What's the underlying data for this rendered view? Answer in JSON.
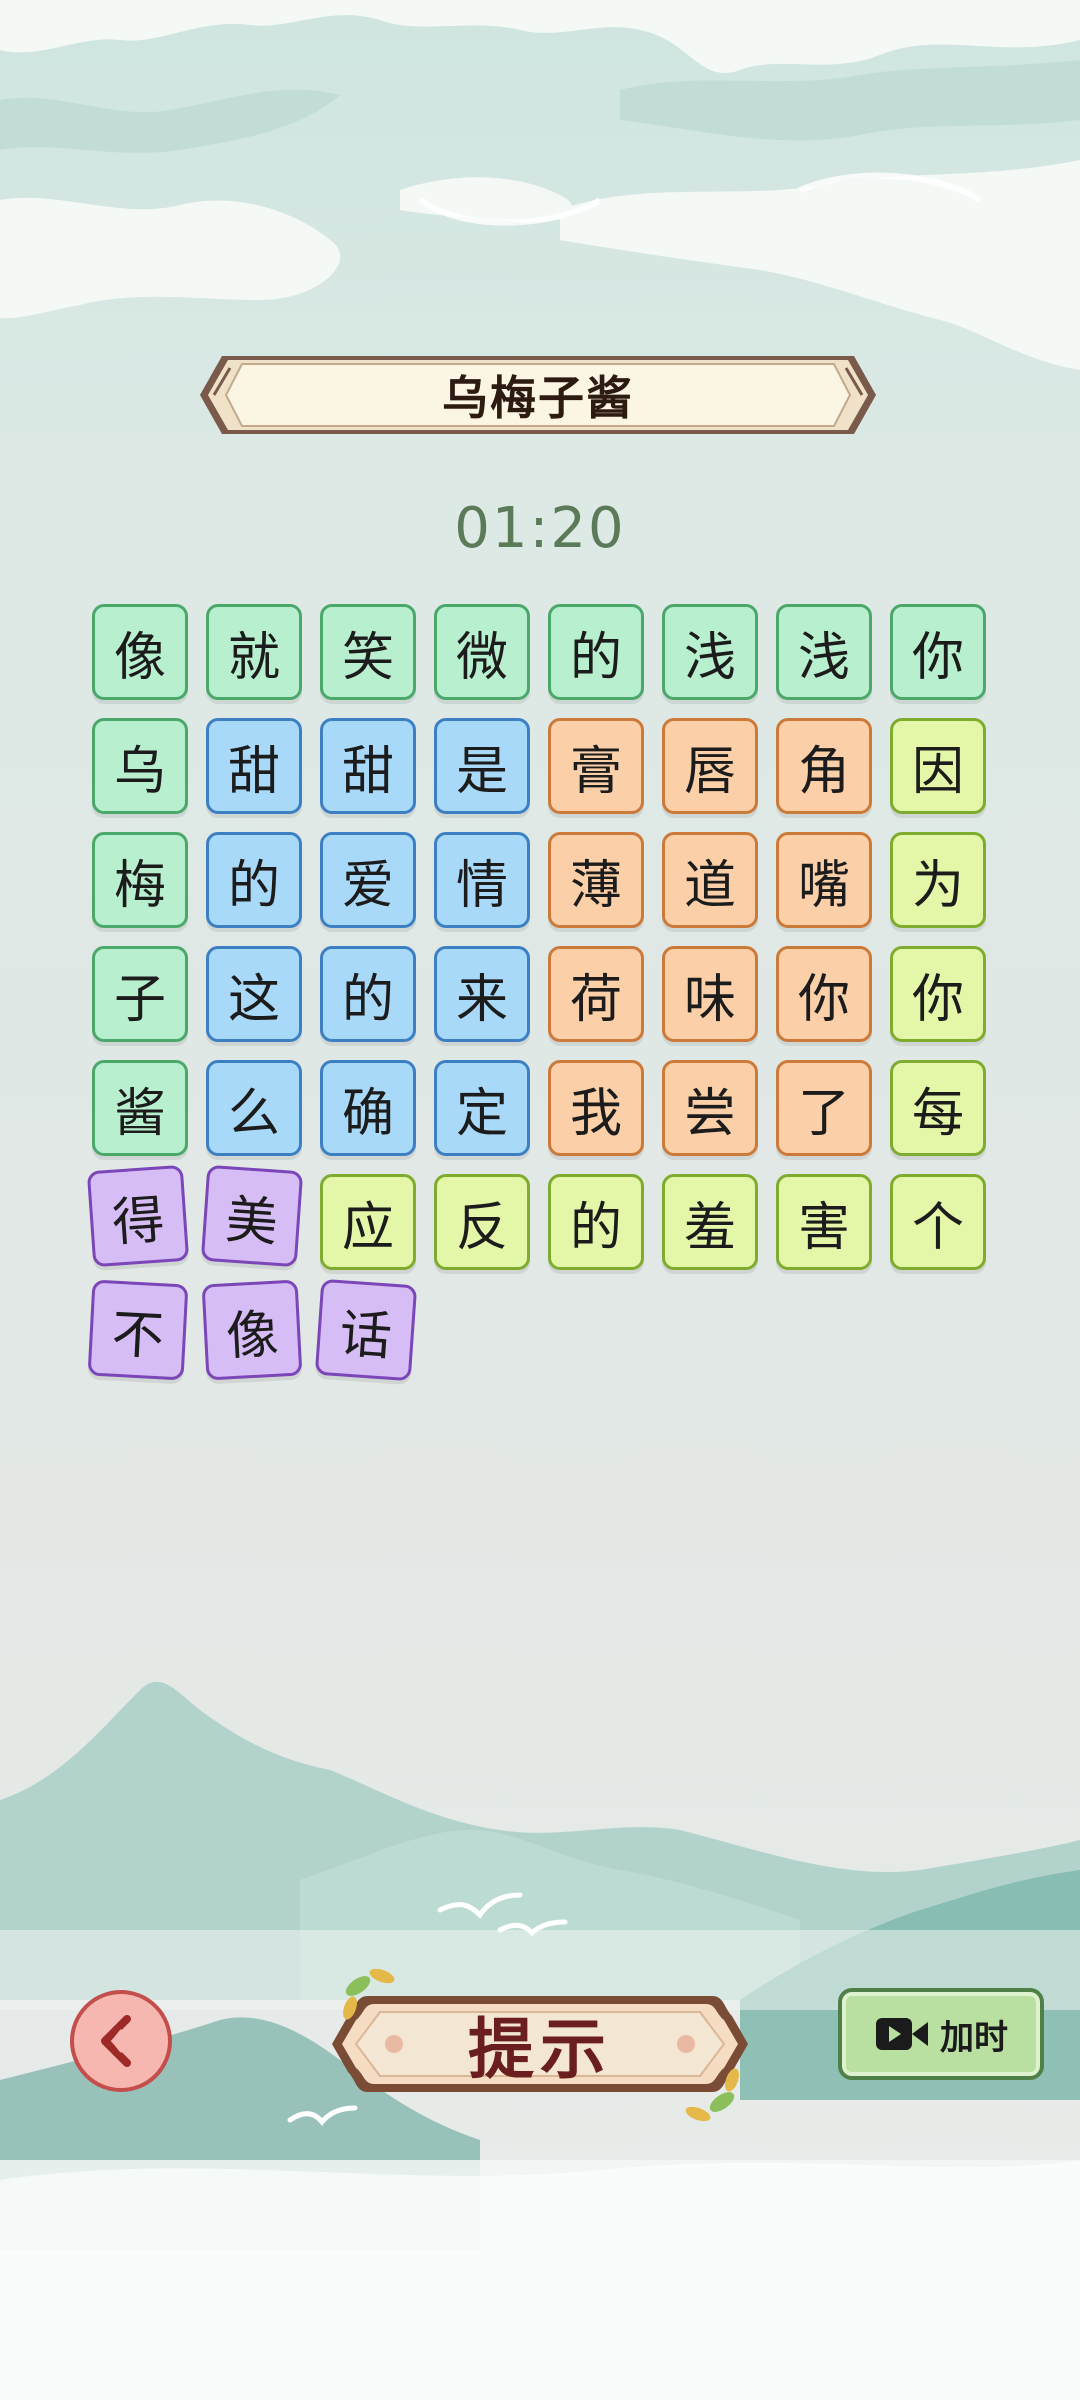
{
  "level": {
    "title": "乌梅子酱"
  },
  "timer": {
    "value": "01:20"
  },
  "grid": {
    "rows": [
      [
        {
          "char": "像",
          "group": "green"
        },
        {
          "char": "就",
          "group": "green"
        },
        {
          "char": "笑",
          "group": "green"
        },
        {
          "char": "微",
          "group": "green"
        },
        {
          "char": "的",
          "group": "green"
        },
        {
          "char": "浅",
          "group": "green"
        },
        {
          "char": "浅",
          "group": "green"
        },
        {
          "char": "你",
          "group": "green"
        }
      ],
      [
        {
          "char": "乌",
          "group": "green"
        },
        {
          "char": "甜",
          "group": "blue"
        },
        {
          "char": "甜",
          "group": "blue"
        },
        {
          "char": "是",
          "group": "blue"
        },
        {
          "char": "膏",
          "group": "orange"
        },
        {
          "char": "唇",
          "group": "orange"
        },
        {
          "char": "角",
          "group": "orange"
        },
        {
          "char": "因",
          "group": "lime"
        }
      ],
      [
        {
          "char": "梅",
          "group": "green"
        },
        {
          "char": "的",
          "group": "blue"
        },
        {
          "char": "爱",
          "group": "blue"
        },
        {
          "char": "情",
          "group": "blue"
        },
        {
          "char": "薄",
          "group": "orange"
        },
        {
          "char": "道",
          "group": "orange"
        },
        {
          "char": "嘴",
          "group": "orange"
        },
        {
          "char": "为",
          "group": "lime"
        }
      ],
      [
        {
          "char": "子",
          "group": "green"
        },
        {
          "char": "这",
          "group": "blue"
        },
        {
          "char": "的",
          "group": "blue"
        },
        {
          "char": "来",
          "group": "blue"
        },
        {
          "char": "荷",
          "group": "orange"
        },
        {
          "char": "味",
          "group": "orange"
        },
        {
          "char": "你",
          "group": "orange"
        },
        {
          "char": "你",
          "group": "lime"
        }
      ],
      [
        {
          "char": "酱",
          "group": "green"
        },
        {
          "char": "么",
          "group": "blue"
        },
        {
          "char": "确",
          "group": "blue"
        },
        {
          "char": "定",
          "group": "blue"
        },
        {
          "char": "我",
          "group": "orange"
        },
        {
          "char": "尝",
          "group": "orange"
        },
        {
          "char": "了",
          "group": "orange"
        },
        {
          "char": "每",
          "group": "lime"
        }
      ],
      [
        {
          "char": "得",
          "group": "purple"
        },
        {
          "char": "美",
          "group": "purple"
        },
        {
          "char": "应",
          "group": "lime"
        },
        {
          "char": "反",
          "group": "lime"
        },
        {
          "char": "的",
          "group": "lime"
        },
        {
          "char": "羞",
          "group": "lime"
        },
        {
          "char": "害",
          "group": "lime"
        },
        {
          "char": "个",
          "group": "lime"
        }
      ],
      [
        {
          "char": "不",
          "group": "purple"
        },
        {
          "char": "像",
          "group": "purple"
        },
        {
          "char": "话",
          "group": "purple"
        }
      ]
    ]
  },
  "controls": {
    "back_icon": "back-arrow-icon",
    "hint_label": "提示",
    "add_time_icon": "video-camera-icon",
    "add_time_label": "加时"
  },
  "colors": {
    "green": "#b8efce",
    "blue": "#a8d9f8",
    "orange": "#fbcfa8",
    "lime": "#e4f7a8",
    "purple": "#d7bdf5"
  }
}
